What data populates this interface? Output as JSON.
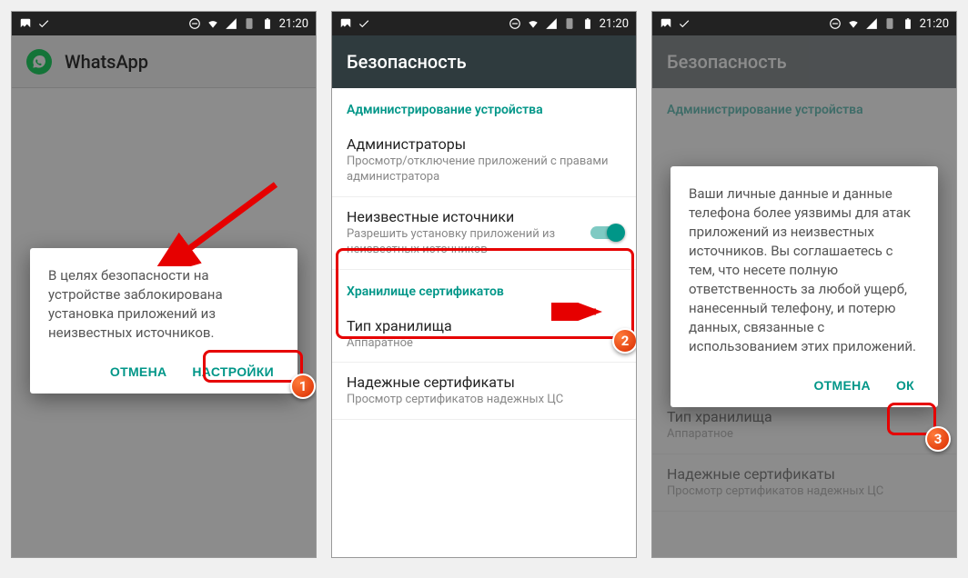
{
  "status": {
    "time": "21:20"
  },
  "screen1": {
    "app_title": "WhatsApp",
    "dialog_text": "В целях безопасности на устройстве заблокирована установка приложений из неизвестных источников.",
    "cancel": "ОТМЕНА",
    "settings": "НАСТРОЙКИ",
    "badge": "1"
  },
  "screen2": {
    "title": "Безопасность",
    "section_admin": "Администрирование устройства",
    "admins_title": "Администраторы",
    "admins_sub": "Просмотр/отключение приложений с правами администратора",
    "unknown_title": "Неизвестные источники",
    "unknown_sub": "Разрешить установку приложений из неизвестных источников",
    "section_cert": "Хранилище сертификатов",
    "storage_title": "Тип хранилища",
    "storage_sub": "Аппаратное",
    "trusted_title": "Надежные сертификаты",
    "trusted_sub": "Просмотр сертификатов надежных ЦС",
    "badge": "2"
  },
  "screen3": {
    "title": "Безопасность",
    "section_admin": "Администрирование устройства",
    "dialog_text": "Ваши личные данные и данные телефона более уязвимы для атак приложений из неизвестных источников. Вы соглашаетесь с тем, что несете полную ответственность за любой ущерб, нанесенный телефону, и потерю данных, связанные с использованием этих приложений.",
    "cancel": "ОТМЕНА",
    "ok": "ОК",
    "storage_title": "Тип хранилища",
    "storage_sub": "Аппаратное",
    "trusted_title": "Надежные сертификаты",
    "trusted_sub": "Просмотр сертификатов надежных ЦС",
    "badge": "3"
  }
}
